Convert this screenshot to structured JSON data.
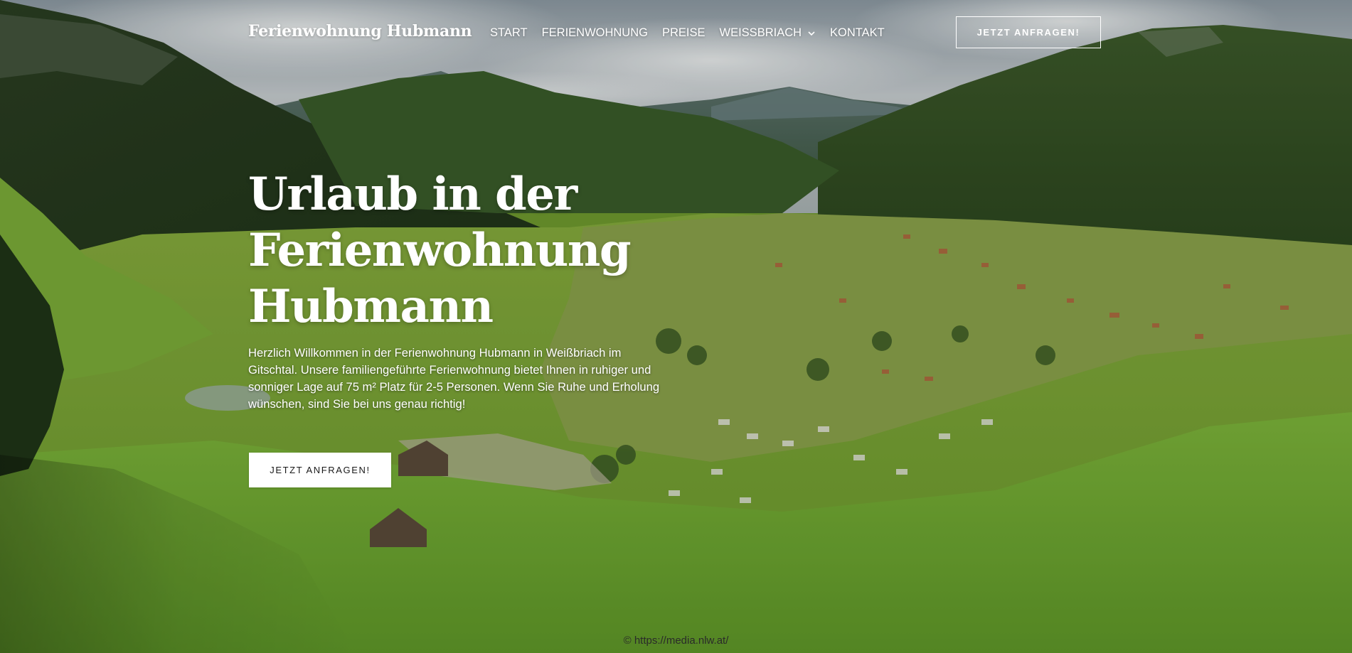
{
  "header": {
    "logo": "Ferienwohnung Hubmann",
    "nav": [
      {
        "label": "START",
        "has_dropdown": false
      },
      {
        "label": "FERIENWOHNUNG",
        "has_dropdown": false
      },
      {
        "label": "PREISE",
        "has_dropdown": false
      },
      {
        "label": "WEISSBRIACH",
        "has_dropdown": true
      },
      {
        "label": "KONTAKT",
        "has_dropdown": false
      }
    ],
    "cta_label": "JETZT ANFRAGEN!"
  },
  "hero": {
    "title_lines": [
      "Urlaub in der",
      "Ferienwohnung",
      "Hubmann"
    ],
    "text": "Herzlich Willkommen in der Ferienwohnung Hubmann in Weißbriach im Gitschtal. Unsere familiengeführte Ferienwohnung bietet Ihnen in ruhiger und sonniger Lage auf 75 m² Platz für 2-5 Personen. Wenn Sie Ruhe und Erholung wünschen, sind Sie bei uns genau richtig!",
    "cta_label": "JETZT ANFRAGEN!",
    "credit": "© https://media.nlw.at/"
  },
  "icons": {
    "dropdown": "chevron-down-icon"
  },
  "colors": {
    "text_on_image": "#ffffff",
    "button_bg": "#ffffff",
    "button_text": "#1a1a1a",
    "meadow": "#7fb53a",
    "forest": "#2f4d22",
    "sky": "#c9d1d6"
  }
}
